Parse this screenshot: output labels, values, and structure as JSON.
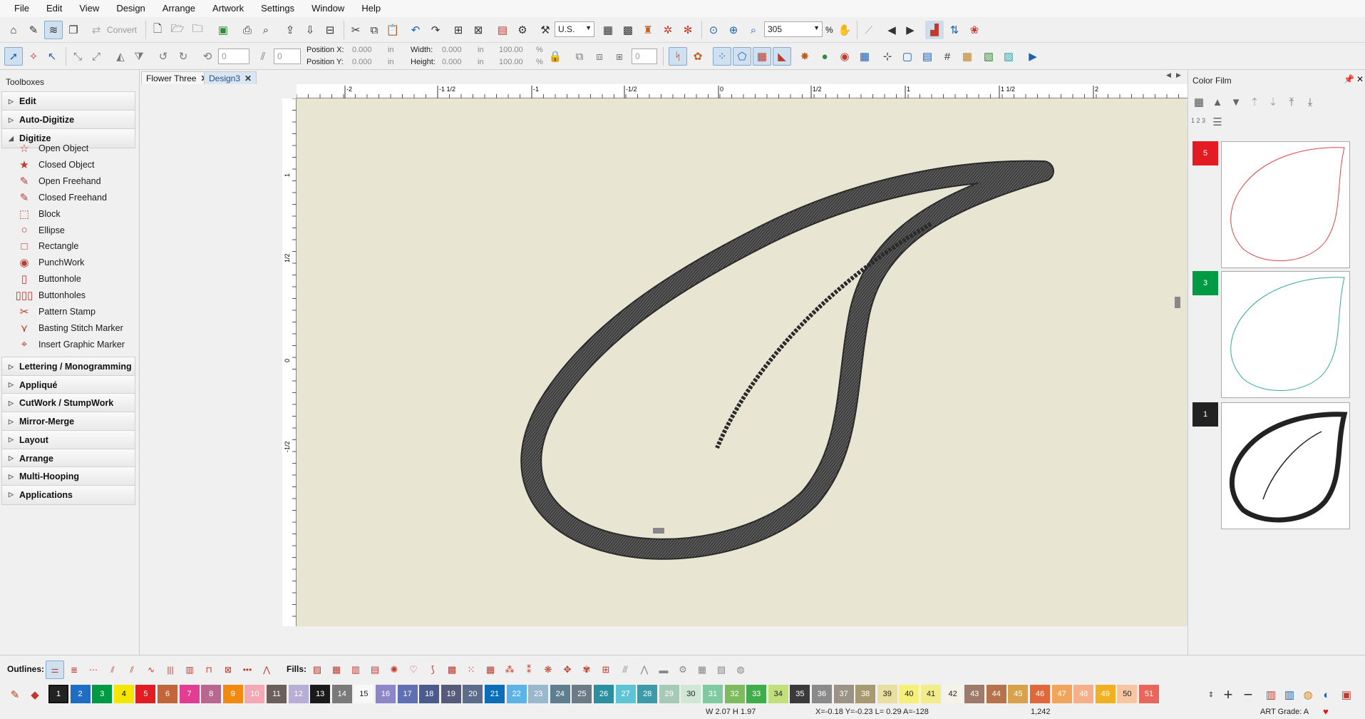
{
  "menu": [
    "File",
    "Edit",
    "View",
    "Design",
    "Arrange",
    "Artwork",
    "Settings",
    "Window",
    "Help"
  ],
  "toolbar": {
    "convert_label": "Convert",
    "units_value": "U.S.",
    "zoom_value": "305",
    "zoom_unit": "%",
    "rotate_value": "0",
    "slant_value": "0",
    "rotate2_value": "0",
    "position_x_label": "Position X:",
    "position_x_value": "0.000",
    "position_y_label": "Position Y:",
    "position_y_value": "0.000",
    "width_label": "Width:",
    "width_value": "0.000",
    "height_label": "Height:",
    "height_value": "0.000",
    "unit_in": "in",
    "width_pct": "100.00",
    "height_pct": "100.00",
    "pct": "%"
  },
  "toolboxes": {
    "title": "Toolboxes",
    "sections_top": [
      "Edit",
      "Auto-Digitize",
      "Digitize"
    ],
    "digitize_tools": [
      "Open Object",
      "Closed Object",
      "Open Freehand",
      "Closed Freehand",
      "Block",
      "Ellipse",
      "Rectangle",
      "PunchWork",
      "Buttonhole",
      "Buttonholes",
      "Pattern Stamp",
      "Basting Stitch Marker",
      "Insert Graphic Marker"
    ],
    "sections_bottom": [
      "Lettering / Monogramming",
      "Appliqué",
      "CutWork / StumpWork",
      "Mirror-Merge",
      "Layout",
      "Arrange",
      "Multi-Hooping",
      "Applications"
    ]
  },
  "tabs": [
    {
      "label": "Flower Three",
      "active": false
    },
    {
      "label": "Design3",
      "active": true
    }
  ],
  "ruler": {
    "h_labels": [
      "-2",
      "-1 1/2",
      "-1",
      "-1/2",
      "0",
      "1/2",
      "1",
      "1 1/2",
      "2"
    ],
    "v_labels": [
      "1",
      "1/2",
      "0",
      "-1/2"
    ]
  },
  "color_film": {
    "title": "Color Film",
    "numbering_label": "1 2 3",
    "items": [
      {
        "number": "5",
        "color": "#e31b23"
      },
      {
        "number": "3",
        "color": "#009a44"
      },
      {
        "number": "1",
        "color": "#222222"
      }
    ]
  },
  "stitch_bar": {
    "outlines_label": "Outlines:",
    "fills_label": "Fills:"
  },
  "palette": {
    "swatches": [
      {
        "n": "1",
        "c": "#222222",
        "t": "#ffffff"
      },
      {
        "n": "2",
        "c": "#1e6fc4",
        "t": "#ffffff"
      },
      {
        "n": "3",
        "c": "#009a44",
        "t": "#ffffff"
      },
      {
        "n": "4",
        "c": "#f5e600",
        "t": "#000000"
      },
      {
        "n": "5",
        "c": "#e31b23",
        "t": "#ffffff"
      },
      {
        "n": "6",
        "c": "#c2663a",
        "t": "#ffffff"
      },
      {
        "n": "7",
        "c": "#e13d92",
        "t": "#ffffff"
      },
      {
        "n": "8",
        "c": "#b8678f",
        "t": "#ffffff"
      },
      {
        "n": "9",
        "c": "#f28a10",
        "t": "#ffffff"
      },
      {
        "n": "10",
        "c": "#f4a7b5",
        "t": "#ffffff"
      },
      {
        "n": "11",
        "c": "#6c5f5b",
        "t": "#ffffff"
      },
      {
        "n": "12",
        "c": "#b7aed6",
        "t": "#ffffff"
      },
      {
        "n": "13",
        "c": "#1a1a1a",
        "t": "#ffffff"
      },
      {
        "n": "14",
        "c": "#7a7a7a",
        "t": "#ffffff"
      },
      {
        "n": "15",
        "c": "#f8f8f8",
        "t": "#222222"
      },
      {
        "n": "16",
        "c": "#8d86c9",
        "t": "#ffffff"
      },
      {
        "n": "17",
        "c": "#5e6fb4",
        "t": "#ffffff"
      },
      {
        "n": "18",
        "c": "#4b5b8c",
        "t": "#ffffff"
      },
      {
        "n": "19",
        "c": "#565b7a",
        "t": "#ffffff"
      },
      {
        "n": "20",
        "c": "#5c6c8a",
        "t": "#ffffff"
      },
      {
        "n": "21",
        "c": "#0a6fb8",
        "t": "#ffffff"
      },
      {
        "n": "22",
        "c": "#5cb3e8",
        "t": "#ffffff"
      },
      {
        "n": "23",
        "c": "#9ab8cc",
        "t": "#ffffff"
      },
      {
        "n": "24",
        "c": "#5f7f90",
        "t": "#ffffff"
      },
      {
        "n": "25",
        "c": "#6d7b87",
        "t": "#ffffff"
      },
      {
        "n": "26",
        "c": "#2b8fa0",
        "t": "#ffffff"
      },
      {
        "n": "27",
        "c": "#5cc4d4",
        "t": "#ffffff"
      },
      {
        "n": "28",
        "c": "#3d9aa8",
        "t": "#ffffff"
      },
      {
        "n": "29",
        "c": "#a6c9b8",
        "t": "#ffffff"
      },
      {
        "n": "30",
        "c": "#cfe7d4",
        "t": "#222222"
      },
      {
        "n": "31",
        "c": "#7fcaa0",
        "t": "#ffffff"
      },
      {
        "n": "32",
        "c": "#7dbb5e",
        "t": "#ffffff"
      },
      {
        "n": "33",
        "c": "#3fae49",
        "t": "#ffffff"
      },
      {
        "n": "34",
        "c": "#c2e07a",
        "t": "#222222"
      },
      {
        "n": "35",
        "c": "#3a3a3a",
        "t": "#ffffff"
      },
      {
        "n": "36",
        "c": "#8a8a8a",
        "t": "#ffffff"
      },
      {
        "n": "37",
        "c": "#9c9285",
        "t": "#ffffff"
      },
      {
        "n": "38",
        "c": "#a89a70",
        "t": "#ffffff"
      },
      {
        "n": "39",
        "c": "#e8e0a0",
        "t": "#222222"
      },
      {
        "n": "40",
        "c": "#f7f078",
        "t": "#222222"
      },
      {
        "n": "41",
        "c": "#f3ec8a",
        "t": "#222222"
      },
      {
        "n": "42",
        "c": "#f5f3e8",
        "t": "#222222"
      },
      {
        "n": "43",
        "c": "#9e7a6a",
        "t": "#ffffff"
      },
      {
        "n": "44",
        "c": "#b5734c",
        "t": "#ffffff"
      },
      {
        "n": "45",
        "c": "#d9a24a",
        "t": "#ffffff"
      },
      {
        "n": "46",
        "c": "#e0673a",
        "t": "#ffffff"
      },
      {
        "n": "47",
        "c": "#f2a45a",
        "t": "#ffffff"
      },
      {
        "n": "48",
        "c": "#f5b08a",
        "t": "#ffffff"
      },
      {
        "n": "49",
        "c": "#f0b020",
        "t": "#ffffff"
      },
      {
        "n": "50",
        "c": "#f7c5a0",
        "t": "#222222"
      },
      {
        "n": "51",
        "c": "#e8665a",
        "t": "#ffffff"
      }
    ]
  },
  "status": {
    "size": "W 2.07 H 1.97",
    "coords": "X=-0.18 Y=-0.23 L= 0.29 A=-128",
    "count": "1,242",
    "grade": "ART Grade: A"
  }
}
